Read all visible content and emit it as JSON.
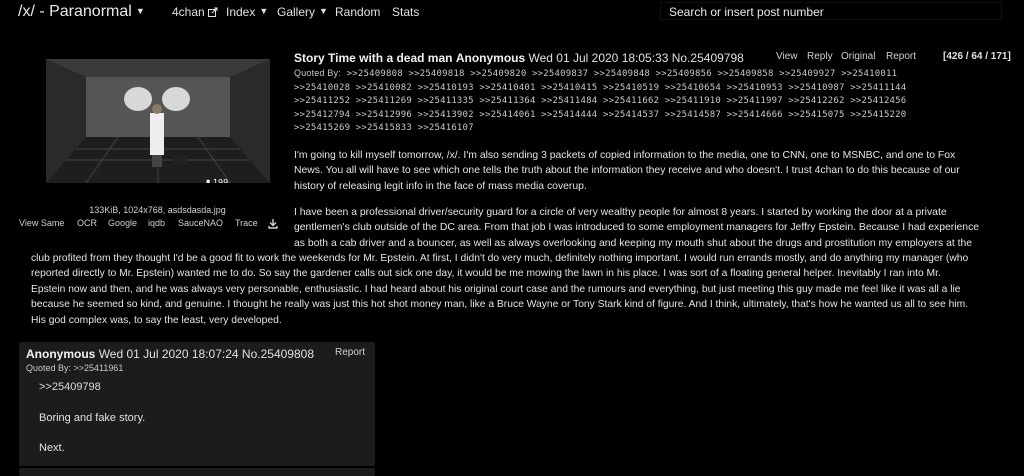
{
  "header": {
    "board_title": "/x/ - Paranormal",
    "nav_items": [
      {
        "label": "4chan"
      },
      {
        "label": "Index"
      },
      {
        "label": "Gallery"
      },
      {
        "label": "Random"
      },
      {
        "label": "Stats"
      }
    ],
    "search_placeholder": "Search or insert post number"
  },
  "op": {
    "file_info": "133KiB, 1024x768, asdsdasda.jpg",
    "image_links": [
      "View Same",
      "OCR",
      "Google",
      "iqdb",
      "SauceNAO",
      "Trace"
    ],
    "subject": "Story Time with a dead man",
    "name": "Anonymous",
    "date": "Wed 01 Jul 2020 18:05:33",
    "post_no": "No.25409798",
    "actions": [
      "View",
      "Reply",
      "Original",
      "Report"
    ],
    "counts": "[426 / 64 / 171]",
    "quoted_by_label": "Quoted By:",
    "quoted_by": [
      ">>25409808 >>25409818 >>25409820 >>25409837 >>25409848 >>25409856 >>25409858 >>25409927 >>25410011",
      ">>25410028 >>25410082 >>25410193 >>25410401 >>25410415 >>25410519 >>25410654 >>25410953 >>25410987 >>25411144",
      ">>25411252 >>25411269 >>25411335 >>25411364 >>25411484 >>25411662 >>25411910 >>25411997 >>25412262 >>25412456",
      ">>25412794 >>25412996 >>25413902 >>25414061 >>25414444 >>25414537 >>25414587 >>25414666 >>25415075 >>25415220",
      ">>25415269 >>25415833 >>25416107"
    ],
    "paragraph1": [
      "I'm going to kill myself tomorrow, /x/. I'm also sending 3 packets of copied information to the media, one to CNN, one to MSNBC, and one to Fox",
      "News. You all will have to see which one tells the truth about the information they receive and who doesn't. I trust 4chan to do this because of our",
      "history of releasing legit info in the face of mass media coverup."
    ],
    "paragraph2": [
      "I have been a professional driver/security guard for a circle of very wealthy people for almost 8 years. I started by working the door at a private",
      "gentlemen's club outside of the DC area. From that job I was introduced to some employment managers for Jeffry Epstein. Because I had experience",
      "as both a cab driver and a bouncer, as well as always overlooking and keeping my mouth shut about the drugs and prostitution my employers at the",
      "club profited from they thought I'd be a good fit to work the weekends for Mr. Epstein. At first, I didn't do very much, definitely nothing important. I would run errands mostly, and do anything my manager (who",
      "reported directly to Mr. Epstein) wanted me to do. So say the gardener calls out sick one day, it would be me mowing the lawn in his place. I was sort of a floating general helper. Inevitably I ran into Mr.",
      "Epstein now and then, and he was always very personable, enthusiastic. I had heard about his original court case and the rumours and everything, but just meeting this guy made me feel like it was all a lie",
      "because he seemed so kind, and genuine. I thought he really was just this hot shot money man, like a Bruce Wayne or Tony Stark kind of figure. And I think, ultimately, that's how he wanted us all to see him.",
      "His god complex was, to say the least, very developed."
    ]
  },
  "reply": {
    "name": "Anonymous",
    "date": "Wed 01 Jul 2020 18:07:24",
    "post_no": "No.25409808",
    "report": "Report",
    "quoted_by": "Quoted By: >>25411961",
    "quote_ref": ">>25409798",
    "lines": [
      "Boring and fake story.",
      "Next."
    ]
  }
}
